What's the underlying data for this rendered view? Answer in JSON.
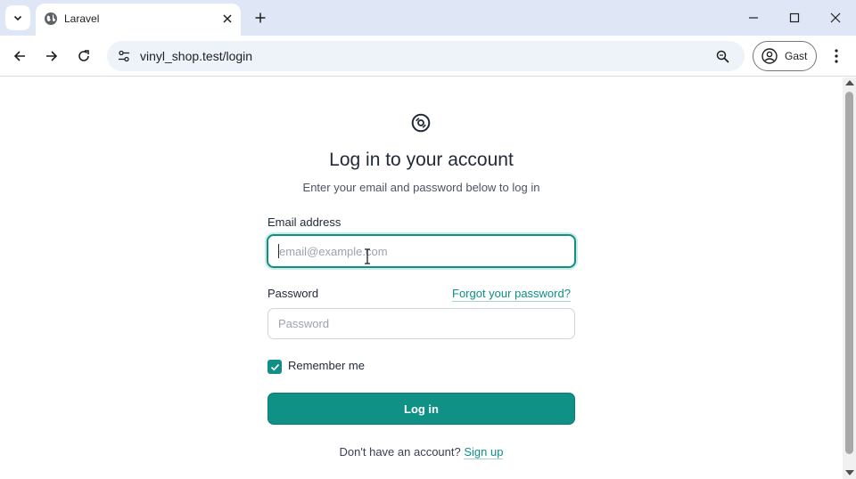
{
  "browser": {
    "tab": {
      "title": "Laravel"
    },
    "url": "vinyl_shop.test/login",
    "profile_label": "Gast"
  },
  "page": {
    "title": "Log in to your account",
    "subtitle": "Enter your email and password below to log in",
    "email": {
      "label": "Email address",
      "placeholder": "email@example.com",
      "value": ""
    },
    "password": {
      "label": "Password",
      "placeholder": "Password",
      "value": ""
    },
    "forgot_link": "Forgot your password?",
    "remember": {
      "label": "Remember me",
      "checked": true
    },
    "login_button": "Log in",
    "signup_prompt": "Don't have an account?",
    "signup_link": "Sign up"
  },
  "colors": {
    "accent": "#0f8f86",
    "titlebar": "#dfe6f5",
    "omnibox": "#eef2f9"
  },
  "icons": [
    "chevron-down-icon",
    "globe-icon",
    "close-icon",
    "plus-icon",
    "minimize-icon",
    "maximize-icon",
    "back-icon",
    "forward-icon",
    "reload-icon",
    "site-settings-icon",
    "zoom-icon",
    "profile-icon",
    "kebab-menu-icon",
    "vinyl-logo-icon",
    "text-cursor-icon",
    "checkmark-icon"
  ]
}
